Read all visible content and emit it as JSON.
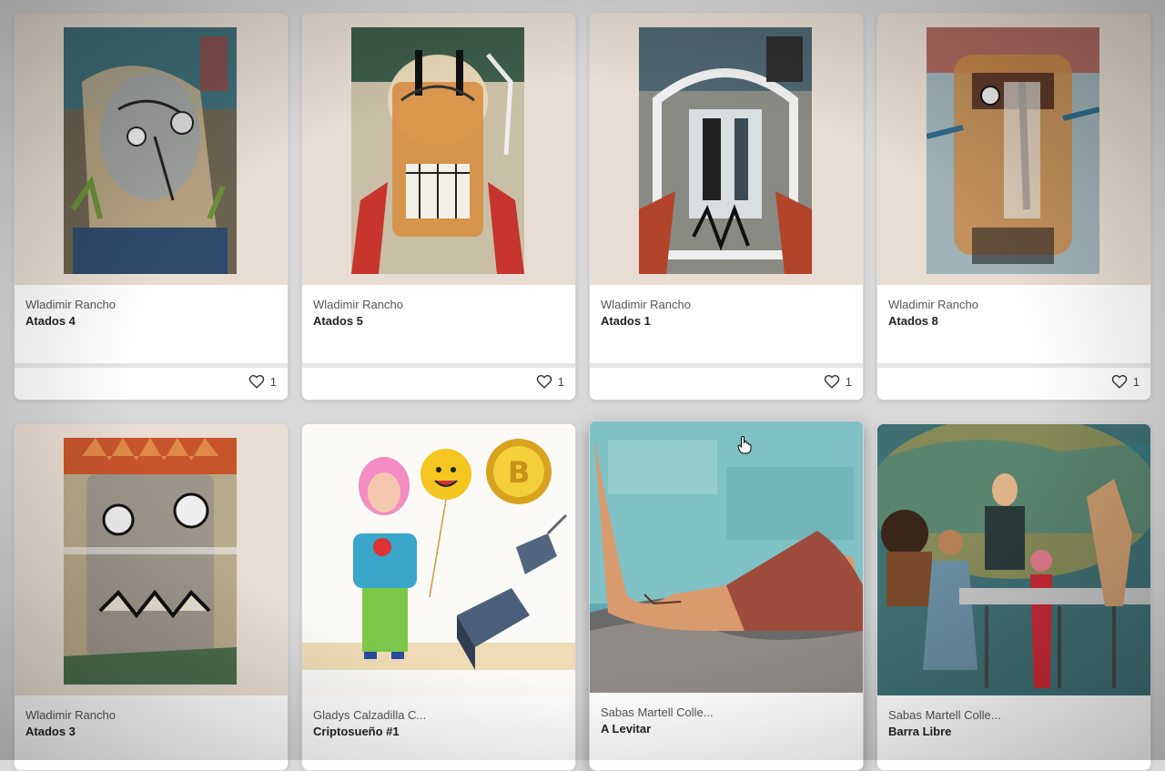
{
  "gallery": {
    "cards": [
      {
        "artist": "Wladimir Rancho",
        "title": "Atados 4",
        "likes": "1"
      },
      {
        "artist": "Wladimir Rancho",
        "title": "Atados 5",
        "likes": "1"
      },
      {
        "artist": "Wladimir Rancho",
        "title": "Atados 1",
        "likes": "1"
      },
      {
        "artist": "Wladimir Rancho",
        "title": "Atados 8",
        "likes": "1"
      },
      {
        "artist": "Wladimir Rancho",
        "title": "Atados 3"
      },
      {
        "artist": "Gladys Calzadilla C...",
        "title": "Criptosueño #1"
      },
      {
        "artist": "Sabas Martell Colle...",
        "title": "A Levitar"
      },
      {
        "artist": "Sabas Martell Colle...",
        "title": "Barra Libre"
      }
    ]
  },
  "icons": {
    "like": "heart-outline-icon",
    "cursor": "hand-pointer-icon"
  },
  "colors": {
    "thumb_bg": "#e8ddd2",
    "text_primary": "#222222",
    "text_secondary": "#555555"
  }
}
